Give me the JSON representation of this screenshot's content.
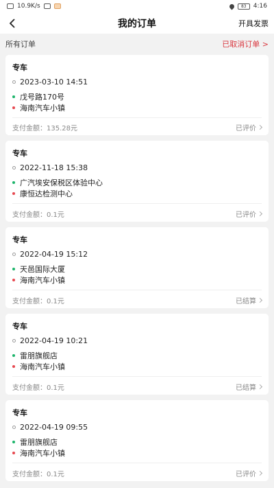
{
  "statusbar": {
    "speed": "10.9K/s",
    "battery": "83",
    "time": "4:16"
  },
  "header": {
    "title": "我的订单",
    "right_action": "开具发票"
  },
  "section": {
    "label": "所有订单",
    "cancelled_link": "已取消订单 >"
  },
  "colors": {
    "accent_red": "#d9363e",
    "start_green": "#1bb46a",
    "end_red": "#e6484f"
  },
  "orders": [
    {
      "type": "专车",
      "time": "2023-03-10 14:51",
      "from": "戊号路170号",
      "to": "海南汽车小镇",
      "pay": "支付金额：135.28元",
      "status": "已评价"
    },
    {
      "type": "专车",
      "time": "2022-11-18 15:38",
      "from": "广汽埃安保税区体验中心",
      "to": "康恒达检测中心",
      "pay": "支付金额：0.1元",
      "status": "已评价"
    },
    {
      "type": "专车",
      "time": "2022-04-19 15:12",
      "from": "天邑国际大厦",
      "to": "海南汽车小镇",
      "pay": "支付金额：0.1元",
      "status": "已结算"
    },
    {
      "type": "专车",
      "time": "2022-04-19 10:21",
      "from": "雷朋旗舰店",
      "to": "海南汽车小镇",
      "pay": "支付金额：0.1元",
      "status": "已结算"
    },
    {
      "type": "专车",
      "time": "2022-04-19 09:55",
      "from": "雷朋旗舰店",
      "to": "海南汽车小镇",
      "pay": "支付金额：0.1元",
      "status": "已评价"
    }
  ]
}
